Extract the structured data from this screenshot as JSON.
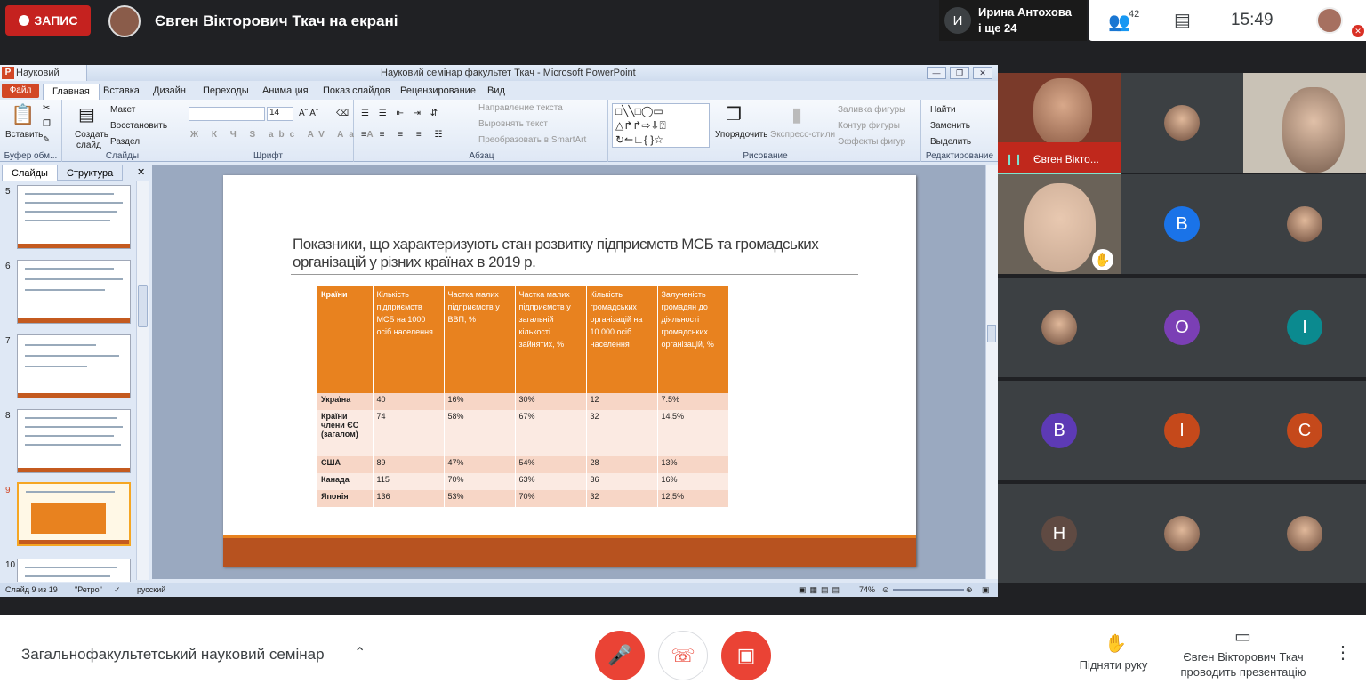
{
  "topbar": {
    "record_label": "ЗАПИС",
    "presenter_title": "Євген Вікторович Ткач на екрані",
    "speaker_initial": "И",
    "speaker_name": "Ирина Антохова",
    "speaker_more": "і ще 24",
    "people_count": "42",
    "time": "15:49"
  },
  "ppt": {
    "tab_title": "Науковий семіна",
    "window_title": "Науковий семінар факультет Ткач - Microsoft PowerPoint",
    "file_btn": "Файл",
    "menu": [
      "Главная",
      "Вставка",
      "Дизайн",
      "Переходы",
      "Анимация",
      "Показ слайдов",
      "Рецензирование",
      "Вид"
    ],
    "ribbon": {
      "paste": "Вставить",
      "clipboard": "Буфер обм...",
      "create_slide_1": "Создать",
      "create_slide_2": "слайд",
      "layout": "Макет",
      "reset": "Восстановить",
      "section": "Раздел",
      "slides_group": "Слайды",
      "font_size": "14",
      "font_group": "Шрифт",
      "text_dir": "Направление текста",
      "align_text": "Выровнять текст",
      "smartart": "Преобразовать в SmartArt",
      "paragraph_group": "Абзац",
      "arrange": "Упорядочить",
      "quick_styles": "Экспресс-стили",
      "shape_fill": "Заливка фигуры",
      "shape_outline": "Контур фигуры",
      "shape_effects": "Эффекты фигур",
      "drawing_group": "Рисование",
      "find": "Найти",
      "replace": "Заменить",
      "select": "Выделить",
      "editing_group": "Редактирование"
    },
    "panel_tabs": [
      "Слайды",
      "Структура"
    ],
    "thumb_numbers": [
      "5",
      "6",
      "7",
      "8",
      "9",
      "10"
    ],
    "slide": {
      "title": "Показники, що характеризують стан розвитку підприємств МСБ та громадських організацій у різних країнах в 2019 р.",
      "headers": [
        "Країни",
        "Кількість підприємств МСБ на 1000 осіб населення",
        "Частка малих підприємств у ВВП, %",
        "Частка малих підприємств у загальній кількості зайнятих, %",
        "Кількість громадських організацій на 10 000 осіб населення",
        "Залученість громадян до діяльності громадських організацій, %"
      ],
      "rows": [
        [
          "Україна",
          "40",
          "16%",
          "30%",
          "12",
          "7.5%"
        ],
        [
          "Країни члени ЄС (загалом)",
          "74",
          "58%",
          "67%",
          "32",
          "14.5%"
        ],
        [
          "США",
          "89",
          "47%",
          "54%",
          "28",
          "13%"
        ],
        [
          "Канада",
          "115",
          "70%",
          "63%",
          "36",
          "16%"
        ],
        [
          "Японія",
          "136",
          "53%",
          "70%",
          "32",
          "12,5%"
        ]
      ]
    },
    "status": {
      "slide_of": "Слайд 9 из 19",
      "theme": "\"Ретро\"",
      "lang": "русский",
      "zoom": "74%"
    }
  },
  "tiles": [
    {
      "name": "Євген Вікто..."
    },
    {
      "initial": "B",
      "color": "#1a73e8"
    },
    {
      "initial": "O",
      "color": "#7b3fb5"
    },
    {
      "initial": "I",
      "color": "#0b8a8f"
    },
    {
      "initial": "B",
      "color": "#5d3ab5"
    },
    {
      "initial": "I",
      "color": "#c5491b"
    },
    {
      "initial": "C",
      "color": "#c5491b"
    },
    {
      "initial": "H",
      "color": "#5f4a42"
    }
  ],
  "bottombar": {
    "meeting_name": "Загальнофакультетський науковий семінар",
    "raise_hand": "Підняти руку",
    "presenting_1": "Євген Вікторович Ткач",
    "presenting_2": "проводить презентацію"
  }
}
